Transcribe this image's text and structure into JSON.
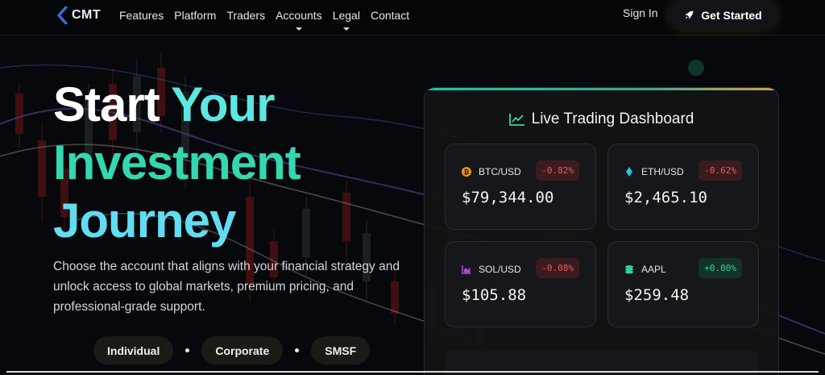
{
  "nav": {
    "logo_text": "CMT",
    "links": [
      {
        "label": "Features",
        "dropdown": false
      },
      {
        "label": "Platform",
        "dropdown": false
      },
      {
        "label": "Traders",
        "dropdown": false
      },
      {
        "label": "Accounts",
        "dropdown": true
      },
      {
        "label": "Legal",
        "dropdown": true
      },
      {
        "label": "Contact",
        "dropdown": false
      }
    ],
    "sign_in": "Sign In",
    "cta": "Get Started"
  },
  "hero": {
    "title_line1_a": "Start ",
    "title_line1_b": "Your",
    "title_line2": "Investment",
    "title_line3": "Journey",
    "description": "Choose the account that aligns with your financial strategy and unlock access to global markets, premium pricing, and professional-grade support.",
    "account_types": [
      "Individual",
      "Corporate",
      "SMSF"
    ]
  },
  "dashboard": {
    "title": "Live Trading Dashboard",
    "tickers": [
      {
        "symbol": "BTC/USD",
        "change": "-0.82%",
        "price": "$79,344.00",
        "icon": "bitcoin-icon",
        "direction": "down"
      },
      {
        "symbol": "ETH/USD",
        "change": "-0.62%",
        "price": "$2,465.10",
        "icon": "ethereum-icon",
        "direction": "down"
      },
      {
        "symbol": "SOL/USD",
        "change": "-0.08%",
        "price": "$105.88",
        "icon": "chart-area-icon",
        "direction": "down"
      },
      {
        "symbol": "AAPL",
        "change": "+0.00%",
        "price": "$259.48",
        "icon": "coins-icon",
        "direction": "up"
      }
    ]
  },
  "colors": {
    "accent_teal": "#34d8b0",
    "accent_cyan": "#5ee6e0",
    "negative": "#f05a5a",
    "positive": "#2ed4a0",
    "cta_glow": "#eaaa28"
  }
}
